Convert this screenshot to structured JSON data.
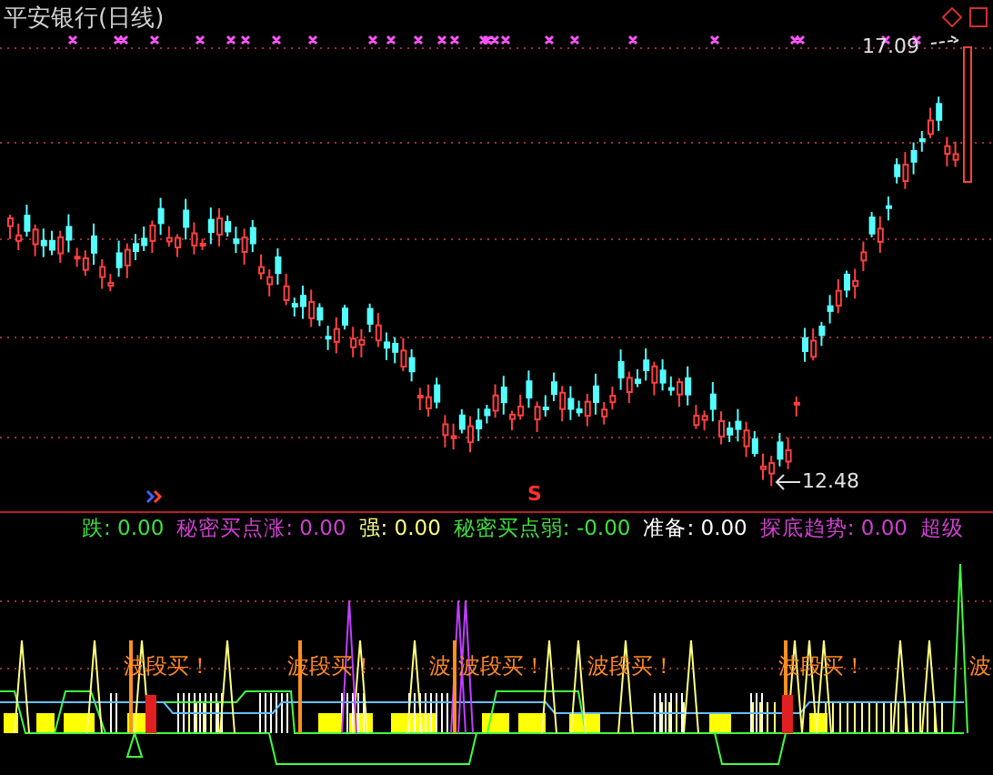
{
  "title": "平安银行(日线)",
  "price_labels": {
    "high": "17.09",
    "low": "12.48"
  },
  "sell_marker": "S",
  "legend": [
    {
      "text": "跌: 0.00",
      "color": "#40e040"
    },
    {
      "text": "秘密买点涨: 0.00",
      "color": "#d040d0"
    },
    {
      "text": "强: 0.00",
      "color": "#ffff80"
    },
    {
      "text": "秘密买点弱: -0.00",
      "color": "#40e040"
    },
    {
      "text": "准备: 0.00",
      "color": "#ffffff"
    },
    {
      "text": "探底趋势: 0.00",
      "color": "#d040d0"
    },
    {
      "text": "超级",
      "color": "#d040d0"
    }
  ],
  "signal_labels": [
    "波段买！",
    "波段买！",
    "波",
    "波段买！",
    "波段买！",
    "波段买！",
    "波"
  ]
}
